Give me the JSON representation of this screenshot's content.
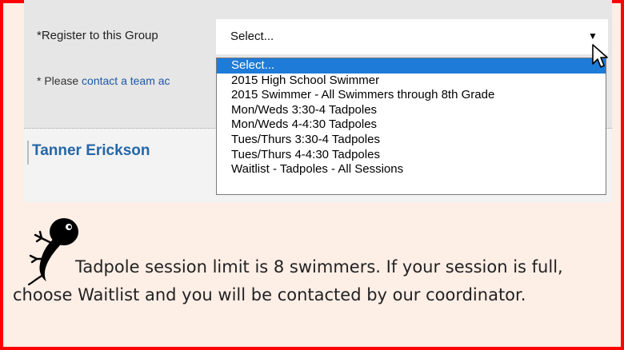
{
  "form": {
    "register_label": "*Register to this Group",
    "select_value": "Select...",
    "please_prefix": "* Please ",
    "please_link": "contact a team ac",
    "athlete_name": "Tanner Erickson"
  },
  "dropdown": {
    "options": [
      "Select...",
      "2015 High School Swimmer",
      "2015 Swimmer - All Swimmers through 8th Grade",
      "Mon/Weds 3:30-4 Tadpoles",
      "Mon/Weds 4-4:30 Tadpoles",
      "Tues/Thurs 3:30-4 Tadpoles",
      "Tues/Thurs 4-4:30 Tadpoles",
      "Waitlist - Tadpoles - All Sessions"
    ],
    "highlighted_index": 0
  },
  "note": {
    "text": "Tadpole session limit is 8 swimmers.  If your session is full, choose Waitlist and you will be contacted by our coordinator."
  },
  "colors": {
    "frame_border": "#ff0000",
    "note_background": "#fdeee6",
    "highlight": "#1e7bd8",
    "link": "#1f57a5",
    "name": "#2466a8"
  }
}
